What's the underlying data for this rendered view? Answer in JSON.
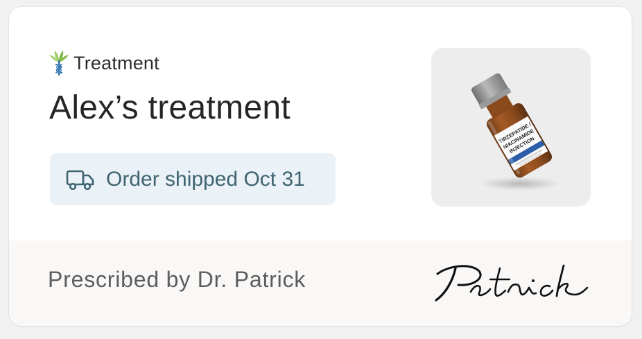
{
  "card": {
    "category_label": "Treatment",
    "title": "Alex’s treatment",
    "status": {
      "icon": "truck-icon",
      "text": "Order shipped Oct 31"
    },
    "product_image": {
      "icon": "medication-vial",
      "label_text": "TIRZEPATIDE / NIACINAMIDE INJECTION"
    },
    "prescriber": {
      "text": "Prescribed by Dr. Patrick",
      "signature_text": "Patrick"
    }
  },
  "colors": {
    "page_background": "#f1f1f1",
    "card_background": "#ffffff",
    "footer_background": "#faf8f6",
    "status_pill_background": "#eaf1f7",
    "status_text": "#406471",
    "title_text": "#262626",
    "brand_green": "#7cb342",
    "brand_blue": "#2e6da4"
  }
}
